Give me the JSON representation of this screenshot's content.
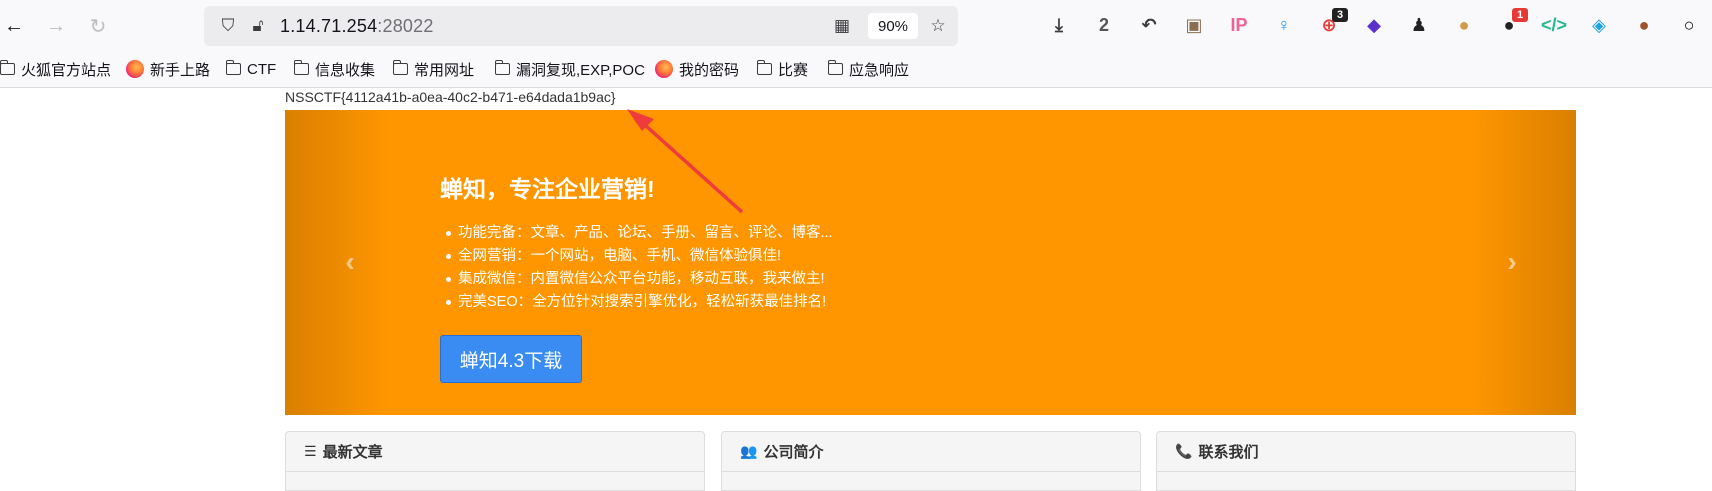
{
  "browser": {
    "url_host": "1.14.71.254",
    "url_port": ":28022",
    "zoom": "90%",
    "extensions": [
      {
        "name": "download-icon",
        "glyph": "⤓",
        "color": "#3b3b3f"
      },
      {
        "name": "counter-extension-icon",
        "glyph": "2",
        "color": "#555555"
      },
      {
        "name": "reply-icon",
        "glyph": "↶",
        "color": "#3b3b3f"
      },
      {
        "name": "image-extension-icon",
        "glyph": "▣",
        "color": "#8a6e52"
      },
      {
        "name": "ip-extension-icon",
        "glyph": "IP",
        "color": "#f06292"
      },
      {
        "name": "pin-extension-icon",
        "glyph": "♀",
        "color": "#2196f3"
      },
      {
        "name": "link-extension-icon",
        "glyph": "⊕",
        "color": "#e53935",
        "badge": "3",
        "badge_color": "#222222"
      },
      {
        "name": "diamond-extension-icon",
        "glyph": "◆",
        "color": "#5b2fc9"
      },
      {
        "name": "spy-extension-icon",
        "glyph": "♟",
        "color": "#222222"
      },
      {
        "name": "cookie-extension-icon",
        "glyph": "●",
        "color": "#d49a4a"
      },
      {
        "name": "mask-extension-icon",
        "glyph": "●",
        "color": "#222222",
        "badge": "1",
        "badge_color": "#e53935"
      },
      {
        "name": "code-extension-icon",
        "glyph": "</>",
        "color": "#25b88f"
      },
      {
        "name": "cube-extension-icon",
        "glyph": "◈",
        "color": "#1fa3e0"
      },
      {
        "name": "cookie-editor-icon",
        "glyph": "●",
        "color": "#a0522d"
      },
      {
        "name": "circle-extension-icon",
        "glyph": "○",
        "color": "#000000"
      }
    ]
  },
  "bookmarks": [
    {
      "label": "火狐官方站点",
      "kind": "folder"
    },
    {
      "label": "新手上路",
      "kind": "firefox"
    },
    {
      "label": "CTF",
      "kind": "folder"
    },
    {
      "label": "信息收集",
      "kind": "folder"
    },
    {
      "label": "常用网址",
      "kind": "folder"
    },
    {
      "label": "漏洞复现,EXP,POC",
      "kind": "folder"
    },
    {
      "label": "我的密码",
      "kind": "firefox"
    },
    {
      "label": "比赛",
      "kind": "folder"
    },
    {
      "label": "应急响应",
      "kind": "folder"
    }
  ],
  "page": {
    "flag": "NSSCTF{4112a41b-a0ea-40c2-b471-e64dada1b9ac}",
    "hero": {
      "title": "蝉知，专注企业营销!",
      "features": [
        "功能完备：文章、产品、论坛、手册、留言、评论、博客...",
        "全网营销：一个网站，电脑、手机、微信体验俱佳!",
        "集成微信：内置微信公众平台功能，移动互联，我来做主!",
        "完美SEO：全方位针对搜索引擎优化，轻松斩获最佳排名!"
      ],
      "download_label": "蝉知4.3下载",
      "prev": "‹",
      "next": "›"
    },
    "panels": [
      {
        "title": "最新文章",
        "icon": "☰",
        "icon_name": "list-icon"
      },
      {
        "title": "公司简介",
        "icon": "👥",
        "icon_name": "users-icon"
      },
      {
        "title": "联系我们",
        "icon": "📞",
        "icon_name": "phone-icon"
      }
    ],
    "colors": {
      "hero": "#ff9600",
      "button": "#3a8cf3",
      "annotation": "#ef3b3b"
    }
  }
}
